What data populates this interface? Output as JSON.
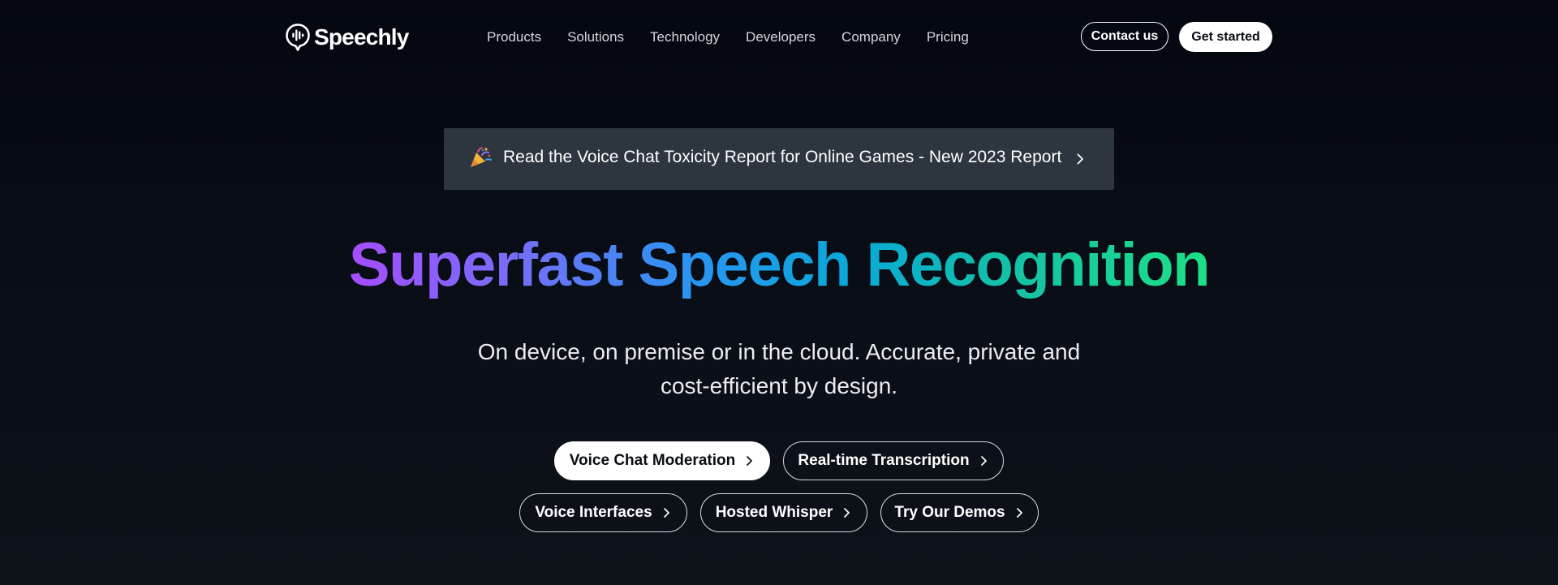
{
  "brand": {
    "name": "Speechly"
  },
  "nav": {
    "items": [
      "Products",
      "Solutions",
      "Technology",
      "Developers",
      "Company",
      "Pricing"
    ]
  },
  "header_actions": {
    "contact_label": "Contact us",
    "get_started_label": "Get started"
  },
  "banner": {
    "icon": "party-popper-icon",
    "text": "Read the Voice Chat Toxicity Report for Online Games - New 2023 Report"
  },
  "hero": {
    "headline": "Superfast Speech Recognition",
    "subtitle_line1": "On device, on premise or in the cloud. Accurate, private and",
    "subtitle_line2": "cost-efficient by design."
  },
  "pills": [
    {
      "label": "Voice Chat Moderation",
      "primary": true
    },
    {
      "label": "Real-time Transcription",
      "primary": false
    },
    {
      "label": "Voice Interfaces",
      "primary": false
    },
    {
      "label": "Hosted Whisper",
      "primary": false
    },
    {
      "label": "Try Our Demos",
      "primary": false
    }
  ],
  "colors": {
    "background": "#04070f",
    "banner_background": "#2d353f",
    "headline_gradient": [
      "#a64dff",
      "#2a95f0",
      "#1ee086"
    ]
  }
}
